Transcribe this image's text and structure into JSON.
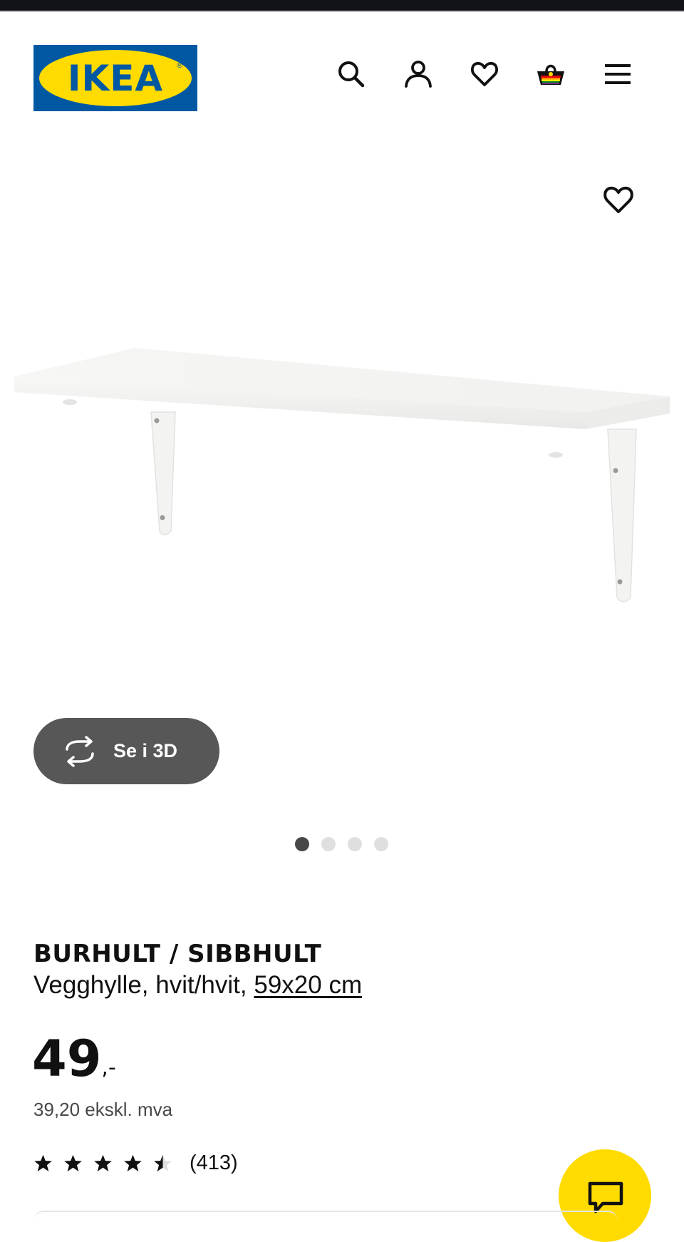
{
  "header": {
    "logo_text": "IKEA",
    "logo_mark": "®",
    "icons": [
      "search-icon",
      "user-icon",
      "heart-icon",
      "basket-icon",
      "menu-icon"
    ]
  },
  "gallery": {
    "view_3d_label": "Se i 3D",
    "total_images": 4,
    "active_index": 0
  },
  "product": {
    "name": "BURHULT / SIBBHULT",
    "description": "Vegghylle, hvit/hvit,",
    "size_link": "59x20 cm",
    "price_integer": "49",
    "price_decimal": ",-",
    "price_excl_vat": "39,20 ekskl. mva",
    "rating": 4.5,
    "reviews_count": "(413)"
  },
  "colors": {
    "ikea_blue": "#0058a3",
    "ikea_yellow": "#ffdb00",
    "button_dark": "#575757"
  }
}
